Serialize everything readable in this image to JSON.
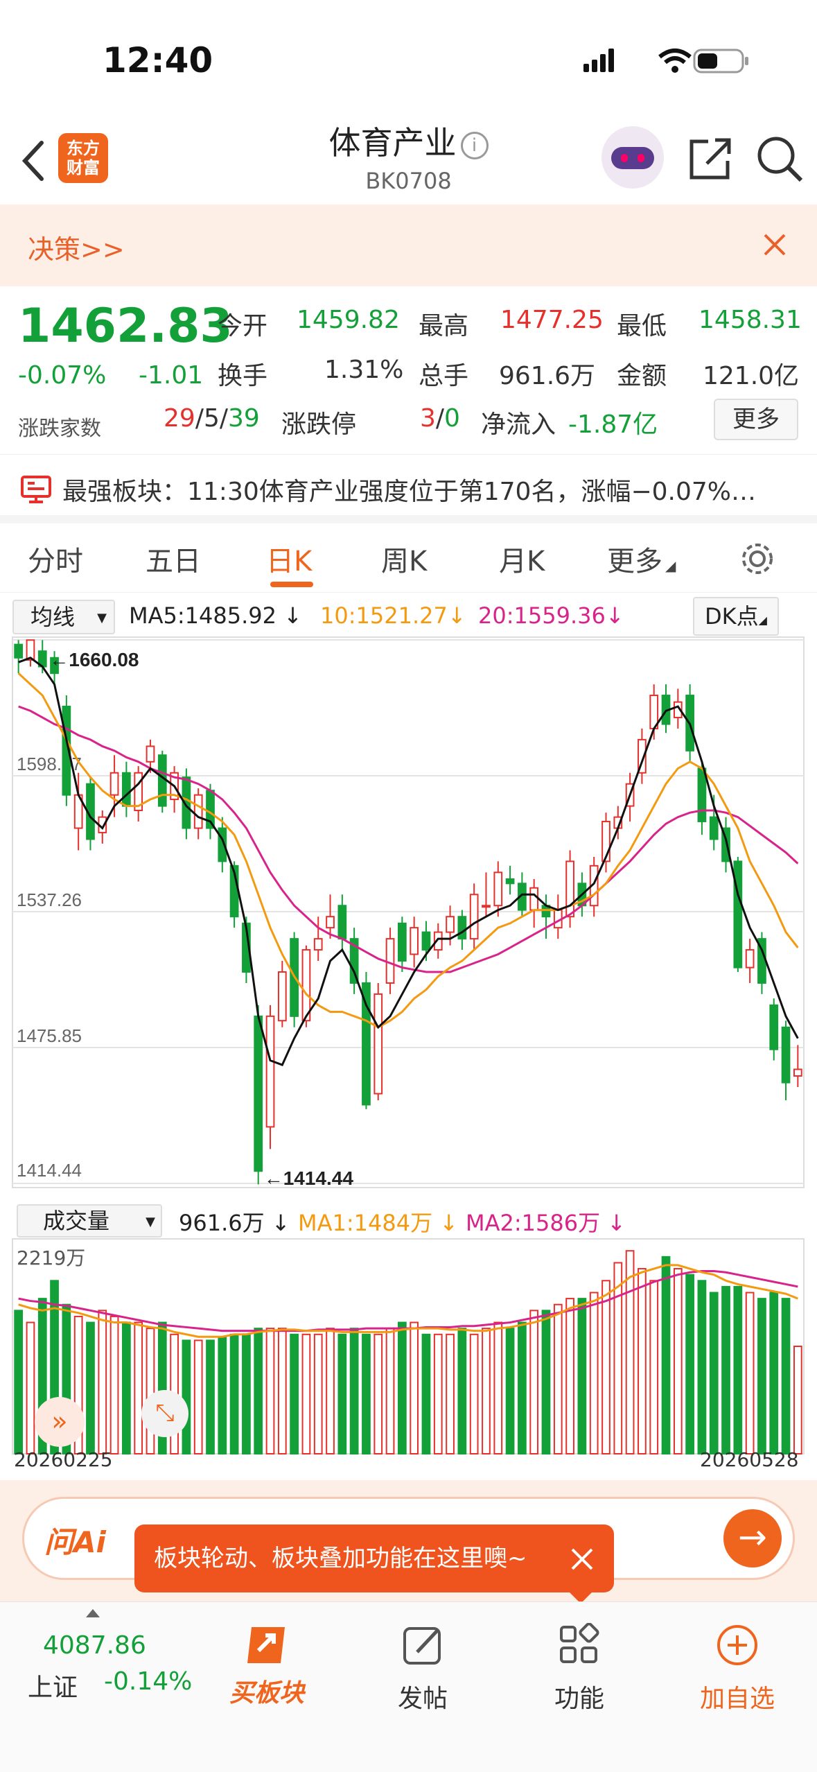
{
  "status_bar": {
    "time": "12:40"
  },
  "nav": {
    "title": "体育产业",
    "code": "BK0708",
    "logo_line1": "东方",
    "logo_line2": "财富"
  },
  "banner": {
    "text": "决策>>"
  },
  "quote": {
    "price": "1462.83",
    "change_pct": "-0.07%",
    "change": "-1.01",
    "open_label": "今开",
    "open": "1459.82",
    "high_label": "最高",
    "high": "1477.25",
    "low_label": "最低",
    "low": "1458.31",
    "turnover_label": "换手",
    "turnover": "1.31%",
    "volume_label": "总手",
    "volume": "961.6万",
    "amount_label": "金额",
    "amount": "121.0亿",
    "breadth_label": "涨跌家数",
    "up": "29",
    "flat": "5",
    "down": "39",
    "limit_label": "涨跌停",
    "limit_up": "3",
    "limit_down": "0",
    "inflow_label": "净流入",
    "inflow": "-1.87亿",
    "more_button": "更多"
  },
  "pankou": {
    "text": "最强板块：11:30体育产业强度位于第170名，涨幅−0.07%…"
  },
  "tabs": [
    "分时",
    "五日",
    "日K",
    "周K",
    "月K",
    "更多"
  ],
  "active_tab": 2,
  "ma_bar": {
    "selector": "均线",
    "ma5": "MA5:1485.92",
    "ma10": "10:1521.27",
    "ma20": "20:1559.36",
    "dk": "DK点"
  },
  "vol_bar": {
    "selector": "成交量",
    "vol": "961.6万",
    "ma1": "MA1:1484万",
    "ma2": "MA2:1586万",
    "max_label": "2219万"
  },
  "chart_data": {
    "type": "candlestick",
    "price_ticks": [
      "1660.08",
      "1598.67",
      "1537.26",
      "1475.85",
      "1414.44"
    ],
    "max_marker": "1660.08",
    "min_marker": "1414.44",
    "x_start": "20260225",
    "x_end": "20260528",
    "candles": [
      [
        1652,
        1658,
        1645,
        1660,
        "d"
      ],
      [
        1651,
        1660,
        1648,
        1660,
        "u"
      ],
      [
        1655,
        1648,
        1645,
        1660,
        "d"
      ],
      [
        1652,
        1645,
        1640,
        1655,
        "d"
      ],
      [
        1630,
        1590,
        1585,
        1635,
        "d"
      ],
      [
        1575,
        1590,
        1565,
        1600,
        "u"
      ],
      [
        1595,
        1570,
        1565,
        1598,
        "d"
      ],
      [
        1573,
        1580,
        1568,
        1583,
        "u"
      ],
      [
        1590,
        1600,
        1580,
        1608,
        "u"
      ],
      [
        1600,
        1585,
        1580,
        1605,
        "d"
      ],
      [
        1583,
        1600,
        1578,
        1603,
        "u"
      ],
      [
        1605,
        1612,
        1600,
        1615,
        "u"
      ],
      [
        1608,
        1585,
        1582,
        1610,
        "d"
      ],
      [
        1588,
        1600,
        1582,
        1603,
        "u"
      ],
      [
        1598,
        1575,
        1570,
        1602,
        "d"
      ],
      [
        1575,
        1590,
        1570,
        1593,
        "u"
      ],
      [
        1592,
        1575,
        1570,
        1595,
        "d"
      ],
      [
        1575,
        1560,
        1555,
        1580,
        "d"
      ],
      [
        1558,
        1535,
        1530,
        1560,
        "d"
      ],
      [
        1532,
        1510,
        1505,
        1535,
        "d"
      ],
      [
        1490,
        1420,
        1414,
        1495,
        "d"
      ],
      [
        1440,
        1490,
        1430,
        1495,
        "u"
      ],
      [
        1488,
        1510,
        1485,
        1515,
        "u"
      ],
      [
        1525,
        1490,
        1485,
        1528,
        "d"
      ],
      [
        1488,
        1520,
        1485,
        1522,
        "u"
      ],
      [
        1520,
        1525,
        1515,
        1535,
        "u"
      ],
      [
        1530,
        1535,
        1525,
        1545,
        "u"
      ],
      [
        1540,
        1525,
        1520,
        1545,
        "d"
      ],
      [
        1525,
        1505,
        1500,
        1530,
        "d"
      ],
      [
        1505,
        1450,
        1448,
        1510,
        "d"
      ],
      [
        1455,
        1500,
        1452,
        1505,
        "u"
      ],
      [
        1505,
        1525,
        1500,
        1530,
        "u"
      ],
      [
        1532,
        1515,
        1510,
        1535,
        "d"
      ],
      [
        1518,
        1530,
        1512,
        1535,
        "u"
      ],
      [
        1528,
        1520,
        1515,
        1533,
        "d"
      ],
      [
        1520,
        1528,
        1516,
        1532,
        "u"
      ],
      [
        1528,
        1535,
        1522,
        1540,
        "u"
      ],
      [
        1535,
        1525,
        1520,
        1538,
        "d"
      ],
      [
        1525,
        1545,
        1520,
        1550,
        "u"
      ],
      [
        1540,
        1540,
        1535,
        1555,
        "u"
      ],
      [
        1540,
        1555,
        1535,
        1560,
        "u"
      ],
      [
        1552,
        1550,
        1545,
        1558,
        "d"
      ],
      [
        1550,
        1538,
        1535,
        1555,
        "d"
      ],
      [
        1538,
        1548,
        1530,
        1552,
        "u"
      ],
      [
        1540,
        1535,
        1525,
        1545,
        "d"
      ],
      [
        1530,
        1538,
        1525,
        1545,
        "u"
      ],
      [
        1535,
        1560,
        1530,
        1565,
        "u"
      ],
      [
        1550,
        1540,
        1535,
        1555,
        "d"
      ],
      [
        1540,
        1558,
        1535,
        1562,
        "u"
      ],
      [
        1560,
        1578,
        1555,
        1582,
        "u"
      ],
      [
        1575,
        1580,
        1570,
        1585,
        "u"
      ],
      [
        1585,
        1595,
        1578,
        1600,
        "u"
      ],
      [
        1600,
        1615,
        1595,
        1620,
        "u"
      ],
      [
        1620,
        1635,
        1615,
        1640,
        "u"
      ],
      [
        1635,
        1622,
        1618,
        1640,
        "d"
      ],
      [
        1625,
        1632,
        1620,
        1638,
        "u"
      ],
      [
        1635,
        1610,
        1605,
        1640,
        "d"
      ],
      [
        1602,
        1578,
        1572,
        1605,
        "d"
      ],
      [
        1580,
        1570,
        1565,
        1590,
        "d"
      ],
      [
        1575,
        1560,
        1555,
        1580,
        "d"
      ],
      [
        1560,
        1512,
        1510,
        1562,
        "d"
      ],
      [
        1512,
        1520,
        1505,
        1525,
        "u"
      ],
      [
        1525,
        1505,
        1500,
        1528,
        "d"
      ],
      [
        1495,
        1475,
        1470,
        1498,
        "d"
      ],
      [
        1485,
        1460,
        1452,
        1488,
        "d"
      ],
      [
        1463,
        1466,
        1458,
        1477,
        "u"
      ]
    ],
    "ma5": [
      1650,
      1652,
      1648,
      1640,
      1615,
      1590,
      1580,
      1575,
      1585,
      1590,
      1595,
      1602,
      1598,
      1594,
      1585,
      1580,
      1578,
      1570,
      1555,
      1530,
      1490,
      1470,
      1468,
      1480,
      1490,
      1498,
      1515,
      1520,
      1510,
      1495,
      1485,
      1490,
      1500,
      1510,
      1518,
      1525,
      1525,
      1528,
      1532,
      1535,
      1538,
      1540,
      1545,
      1545,
      1540,
      1538,
      1540,
      1545,
      1550,
      1562,
      1575,
      1590,
      1605,
      1620,
      1628,
      1630,
      1622,
      1605,
      1585,
      1570,
      1545,
      1530,
      1520,
      1505,
      1490,
      1480
    ],
    "ma10": [
      1645,
      1640,
      1635,
      1625,
      1615,
      1605,
      1598,
      1592,
      1588,
      1585,
      1585,
      1588,
      1590,
      1590,
      1588,
      1585,
      1582,
      1578,
      1572,
      1560,
      1545,
      1530,
      1518,
      1508,
      1500,
      1495,
      1492,
      1492,
      1490,
      1488,
      1485,
      1488,
      1492,
      1498,
      1502,
      1508,
      1512,
      1515,
      1520,
      1525,
      1530,
      1532,
      1535,
      1538,
      1538,
      1538,
      1540,
      1542,
      1545,
      1550,
      1558,
      1565,
      1575,
      1585,
      1595,
      1602,
      1605,
      1602,
      1595,
      1585,
      1575,
      1560,
      1550,
      1540,
      1528,
      1521
    ],
    "ma20": [
      1630,
      1628,
      1625,
      1622,
      1620,
      1617,
      1615,
      1612,
      1610,
      1607,
      1605,
      1602,
      1600,
      1598,
      1597,
      1595,
      1592,
      1588,
      1582,
      1575,
      1565,
      1555,
      1547,
      1540,
      1535,
      1530,
      1527,
      1525,
      1522,
      1519,
      1516,
      1514,
      1512,
      1511,
      1510,
      1510,
      1510,
      1512,
      1514,
      1516,
      1518,
      1521,
      1524,
      1527,
      1530,
      1533,
      1536,
      1540,
      1545,
      1550,
      1555,
      1560,
      1566,
      1572,
      1577,
      1580,
      1582,
      1583,
      1583,
      1582,
      1580,
      1576,
      1572,
      1568,
      1564,
      1559
    ],
    "volumes": [
      1.2,
      1.1,
      1.3,
      1.45,
      1.25,
      1.15,
      1.1,
      1.2,
      1.15,
      1.1,
      1.1,
      1.05,
      1.1,
      1.0,
      0.95,
      0.95,
      0.95,
      0.98,
      1.0,
      1.0,
      1.05,
      1.05,
      1.05,
      1.0,
      1.0,
      1.0,
      1.05,
      1.0,
      1.05,
      1.0,
      1.0,
      1.05,
      1.1,
      1.1,
      1.0,
      1.0,
      1.0,
      1.05,
      1.0,
      1.05,
      1.1,
      1.05,
      1.1,
      1.2,
      1.2,
      1.25,
      1.3,
      1.3,
      1.35,
      1.45,
      1.6,
      1.7,
      1.55,
      1.45,
      1.65,
      1.55,
      1.5,
      1.45,
      1.35,
      1.4,
      1.4,
      1.35,
      1.3,
      1.35,
      1.3,
      0.9
    ],
    "vol_ma1": [
      1.25,
      1.22,
      1.2,
      1.22,
      1.2,
      1.18,
      1.15,
      1.12,
      1.1,
      1.1,
      1.08,
      1.06,
      1.05,
      1.02,
      1.0,
      0.98,
      0.98,
      0.98,
      1.0,
      1.0,
      1.02,
      1.03,
      1.04,
      1.04,
      1.03,
      1.03,
      1.03,
      1.02,
      1.02,
      1.02,
      1.02,
      1.02,
      1.04,
      1.05,
      1.05,
      1.05,
      1.04,
      1.04,
      1.03,
      1.03,
      1.05,
      1.06,
      1.08,
      1.1,
      1.13,
      1.17,
      1.22,
      1.25,
      1.28,
      1.33,
      1.4,
      1.48,
      1.52,
      1.55,
      1.58,
      1.58,
      1.55,
      1.52,
      1.5,
      1.45,
      1.42,
      1.4,
      1.38,
      1.36,
      1.34,
      1.3
    ],
    "vol_ma2": [
      1.3,
      1.28,
      1.27,
      1.25,
      1.24,
      1.22,
      1.2,
      1.18,
      1.16,
      1.14,
      1.12,
      1.1,
      1.08,
      1.07,
      1.06,
      1.05,
      1.04,
      1.03,
      1.03,
      1.03,
      1.03,
      1.03,
      1.03,
      1.03,
      1.03,
      1.04,
      1.04,
      1.04,
      1.04,
      1.05,
      1.05,
      1.05,
      1.05,
      1.05,
      1.06,
      1.06,
      1.06,
      1.07,
      1.07,
      1.08,
      1.09,
      1.1,
      1.12,
      1.14,
      1.16,
      1.18,
      1.2,
      1.22,
      1.25,
      1.28,
      1.32,
      1.36,
      1.4,
      1.44,
      1.47,
      1.5,
      1.52,
      1.53,
      1.53,
      1.52,
      1.5,
      1.48,
      1.46,
      1.44,
      1.42,
      1.4
    ],
    "vol_max": 1.8
  },
  "wenai": {
    "logo": "问Ai",
    "tooltip": "板块轮动、板块叠加功能在这里噢~"
  },
  "bottom": {
    "index_value": "4087.86",
    "index_name": "上证",
    "index_change": "-0.14%",
    "buy": "买板块",
    "post": "发帖",
    "func": "功能",
    "add": "加自选"
  }
}
